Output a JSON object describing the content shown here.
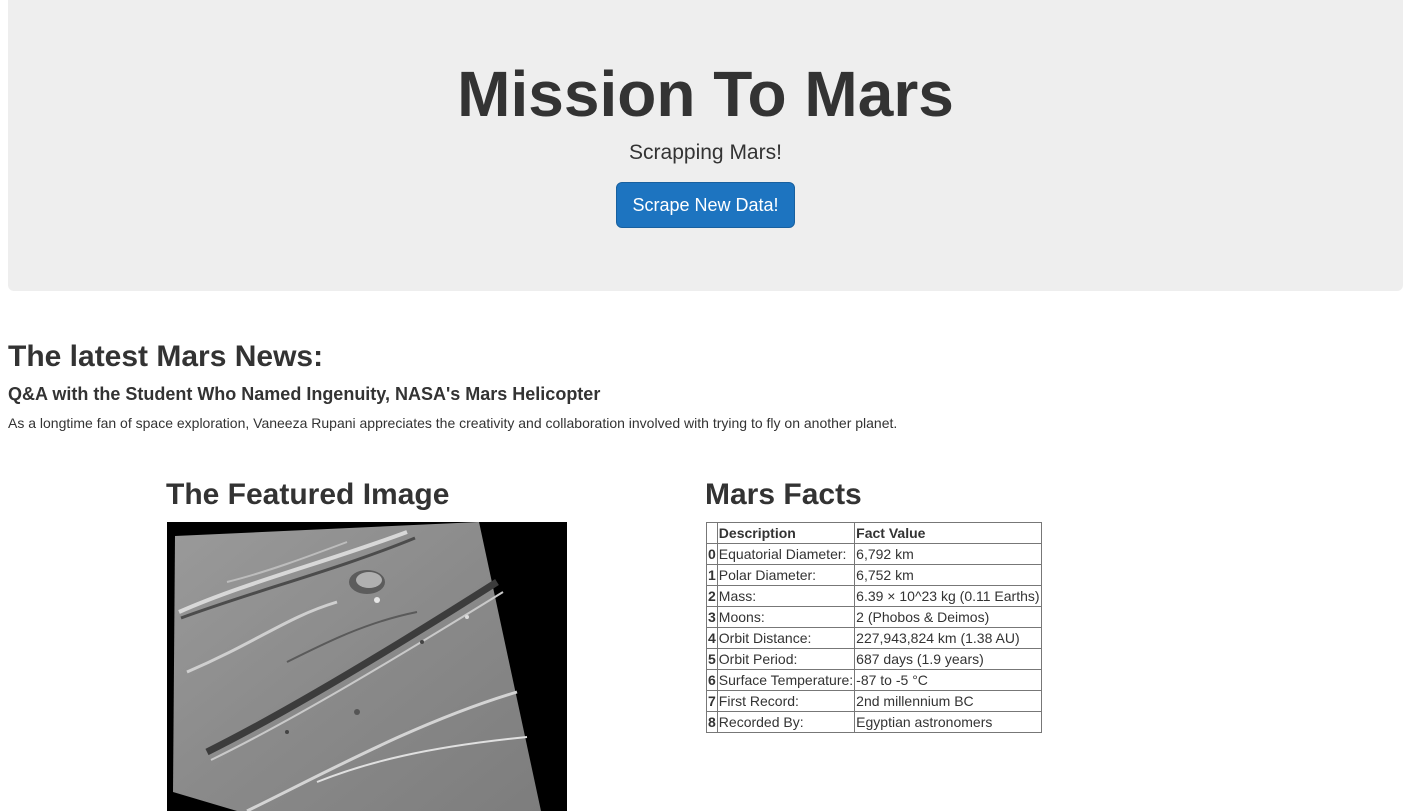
{
  "header": {
    "title": "Mission To Mars",
    "subtitle": "Scrapping Mars!",
    "scrape_button": "Scrape New Data!"
  },
  "news": {
    "heading": "The latest Mars News:",
    "title": "Q&A with the Student Who Named Ingenuity, NASA's Mars Helicopter",
    "teaser": "As a longtime fan of space exploration, Vaneeza Rupani appreciates the creativity and collaboration involved with trying to fly on another planet."
  },
  "featured": {
    "heading": "The Featured Image"
  },
  "facts": {
    "heading": "Mars Facts",
    "columns": [
      "",
      "Description",
      "Fact Value"
    ],
    "rows": [
      {
        "index": "0",
        "description": "Equatorial Diameter:",
        "value": "6,792 km"
      },
      {
        "index": "1",
        "description": "Polar Diameter:",
        "value": "6,752 km"
      },
      {
        "index": "2",
        "description": "Mass:",
        "value": "6.39 × 10^23 kg (0.11 Earths)"
      },
      {
        "index": "3",
        "description": "Moons:",
        "value": "2 (Phobos & Deimos)"
      },
      {
        "index": "4",
        "description": "Orbit Distance:",
        "value": "227,943,824 km (1.38 AU)"
      },
      {
        "index": "5",
        "description": "Orbit Period:",
        "value": "687 days (1.9 years)"
      },
      {
        "index": "6",
        "description": "Surface Temperature:",
        "value": "-87 to -5 °C"
      },
      {
        "index": "7",
        "description": "First Record:",
        "value": "2nd millennium BC"
      },
      {
        "index": "8",
        "description": "Recorded By:",
        "value": "Egyptian astronomers"
      }
    ]
  }
}
